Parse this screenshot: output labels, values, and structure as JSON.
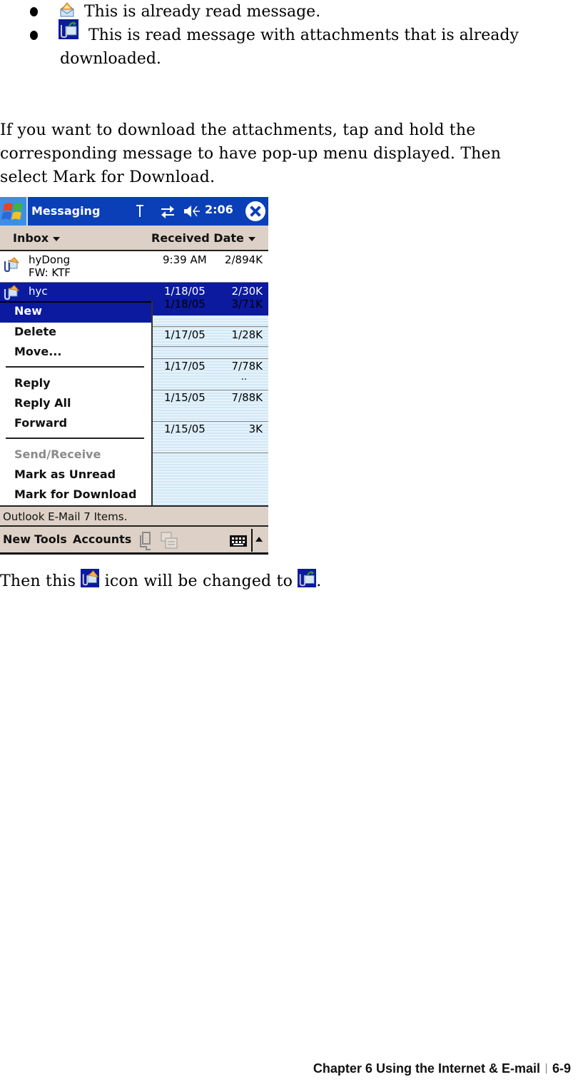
{
  "bullets": [
    {
      "icon": "read-message-icon",
      "text": "This is already read message."
    },
    {
      "icon": "downloaded-attachment-message-icon",
      "text_line1": "This is read message with attachments that is already",
      "text_line2": "downloaded."
    }
  ],
  "paragraph": {
    "line1": "If you want to download the attachments, tap and hold the",
    "line2": "corresponding message to have pop-up menu displayed. Then",
    "line3": "select Mark for Download."
  },
  "device": {
    "title": "Messaging",
    "clock": "2:06",
    "tray_icons": [
      "signal-antenna-icon",
      "sync-arrows-icon",
      "speaker-icon"
    ],
    "nav": {
      "folder": "Inbox",
      "sort": "Received Date"
    },
    "messages": [
      {
        "from": "hyDong",
        "subject": "FW: KTF",
        "date": "9:39 AM",
        "size": "2/894K"
      },
      {
        "from": "hyc",
        "subject": "",
        "date": "1/18/05",
        "size": "2/30K",
        "selected": true
      },
      {
        "from": "",
        "subject": "",
        "date": "1/18/05",
        "size": "3/71K"
      },
      {
        "from": "",
        "subject": "",
        "date": "1/17/05",
        "size": "1/28K"
      },
      {
        "from": "",
        "subject": "",
        "date": "1/17/05",
        "size": "7/78K",
        "more": ".."
      },
      {
        "from": "",
        "subject": "",
        "date": "1/15/05",
        "size": "7/88K"
      },
      {
        "from": "",
        "subject": "",
        "date": "1/15/05",
        "size": "3K"
      }
    ],
    "context_menu": {
      "items": [
        {
          "label": "New",
          "highlighted": true
        },
        {
          "label": "Delete"
        },
        {
          "label": "Move..."
        },
        {
          "label": "Reply"
        },
        {
          "label": "Reply All"
        },
        {
          "label": "Forward"
        },
        {
          "label": "Send/Receive",
          "disabled": true
        },
        {
          "label": "Mark as Unread"
        },
        {
          "label": "Mark for Download"
        }
      ]
    },
    "status": "Outlook E-Mail  7 Items.",
    "menubar": {
      "new": "New",
      "tools": "Tools",
      "accounts": "Accounts"
    }
  },
  "after_text": {
    "before": "Then this",
    "middle": "icon will be changed to",
    "after": "."
  },
  "footer": {
    "chapter": "Chapter 6 Using the Internet & E-mail",
    "page": "6-9"
  },
  "colors": {
    "title_bar": "#0a3fb8",
    "selection": "#0b1a9e",
    "bar_bg": "#ddd0c6",
    "list_stripe": "#d3e8f6"
  }
}
